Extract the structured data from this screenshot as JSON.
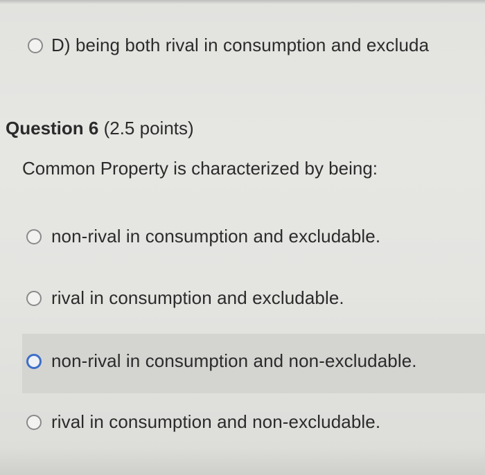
{
  "previous_question": {
    "option_d": "D) being both rival in consumption and excluda"
  },
  "question": {
    "title": "Question 6",
    "points": "(2.5 points)",
    "prompt": "Common Property is characterized by being:",
    "options": [
      {
        "label": "non-rival in consumption and excludable."
      },
      {
        "label": "rival in consumption and excludable."
      },
      {
        "label": "non-rival in consumption and non-excludable.",
        "focused": true
      },
      {
        "label": "rival in consumption and non-excludable."
      }
    ]
  },
  "colors": {
    "focus_ring": "#3d6fc9",
    "highlight_row": "#d4d4d1",
    "text": "#2b2b2b"
  }
}
